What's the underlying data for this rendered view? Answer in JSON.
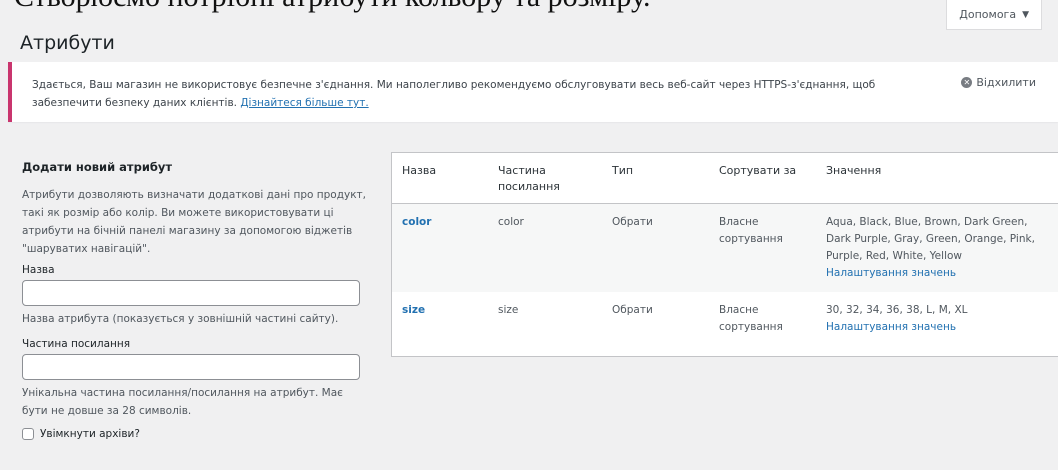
{
  "caption": "Створюємо потрібні атрибути кольору та розміру.",
  "help_tab": {
    "label": "Допомога"
  },
  "page": {
    "title": "Атрибути"
  },
  "notice": {
    "text": "Здається, Ваш магазин не використовує безпечне з'єднання. Ми наполегливо рекомендуємо обслуговувати весь веб-сайт через HTTPS-з'єднання, щоб забезпечити безпеку даних клієнтів.",
    "link": "Дізнайтеся більше тут.",
    "dismiss": "Відхилити"
  },
  "form": {
    "heading": "Додати новий атрибут",
    "description": "Атрибути дозволяють визначати додаткові дані про продукт, такі як розмір або колір. Ви можете використовувати ці атрибути на бічній панелі магазину за допомогою віджетів \"шаруватих навігацій\".",
    "name_label": "Назва",
    "name_value": "",
    "name_help": "Назва атрибута (показується у зовнішній частині сайту).",
    "slug_label": "Частина посилання",
    "slug_value": "",
    "slug_help": "Унікальна частина посилання/посилання на атрибут. Має бути не довше за 28 символів.",
    "archives_label": "Увімкнути архіви?"
  },
  "table": {
    "headers": {
      "name": "Назва",
      "slug": "Частина посилання",
      "type": "Тип",
      "order": "Сортувати за",
      "terms": "Значення"
    },
    "rows": [
      {
        "name": "color",
        "slug": "color",
        "type": "Обрати",
        "order": "Власне сортування",
        "terms": "Aqua, Black, Blue, Brown, Dark Green, Dark Purple, Gray, Green, Orange, Pink, Purple, Red, White, Yellow",
        "configure": "Налаштування значень"
      },
      {
        "name": "size",
        "slug": "size",
        "type": "Обрати",
        "order": "Власне сортування",
        "terms": "30, 32, 34, 36, 38, L, M, XL",
        "configure": "Налаштування значень"
      }
    ]
  }
}
